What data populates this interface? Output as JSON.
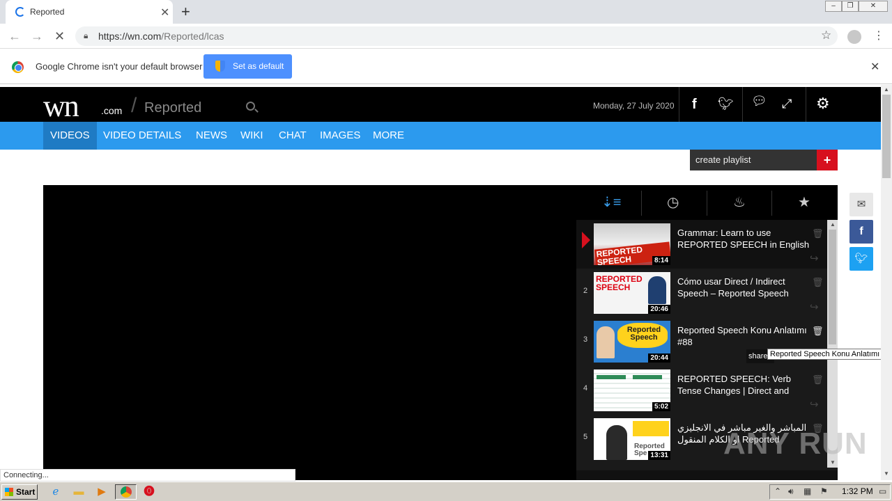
{
  "browser": {
    "tab_title": "Reported",
    "url_host": "https://wn.com",
    "url_path": "/Reported/lcas",
    "infobar_text": "Google Chrome isn't your default browser",
    "infobar_button": "Set as default",
    "status_text": "Connecting..."
  },
  "site": {
    "logo_wn": "wn",
    "logo_com": ".com",
    "section": "Reported",
    "date": "Monday, 27 July 2020",
    "nav": [
      "VIDEOS",
      "VIDEO DETAILS",
      "NEWS",
      "WIKI",
      "CHAT",
      "IMAGES",
      "MORE"
    ],
    "create_playlist": "create playlist",
    "add_playlist": "+"
  },
  "playlist": [
    {
      "num": "",
      "title": "Grammar: Learn to use REPORTED SPEECH in English",
      "duration": "8:14",
      "thumb_text": "REPORTED SPEECH"
    },
    {
      "num": "2",
      "title": "Cómo usar Direct / Indirect Speech – Reported Speech",
      "duration": "20:46",
      "thumb_text": "REPORTED SPEECH"
    },
    {
      "num": "3",
      "title": "Reported Speech Konu Anlatımı #88",
      "duration": "20:44",
      "thumb_text": "Reported Speech"
    },
    {
      "num": "4",
      "title": "REPORTED SPEECH: Verb Tense Changes | Direct and",
      "duration": "5:02",
      "thumb_text": ""
    },
    {
      "num": "5",
      "title": "المباشر والغير مباشر في الانجليزي او الكلام المنقول Reported Speech | Direct",
      "duration": "13:31",
      "thumb_text": "Reported Spe"
    }
  ],
  "share_label": "share",
  "tooltip": "Reported Speech Konu Anlatımı #88",
  "watermark": "ANY RUN",
  "taskbar": {
    "start": "Start",
    "clock": "1:32 PM"
  },
  "colors": {
    "nav_blue": "#2c9aee",
    "nav_active": "#1f7bc4",
    "accent_red": "#d7101e"
  }
}
